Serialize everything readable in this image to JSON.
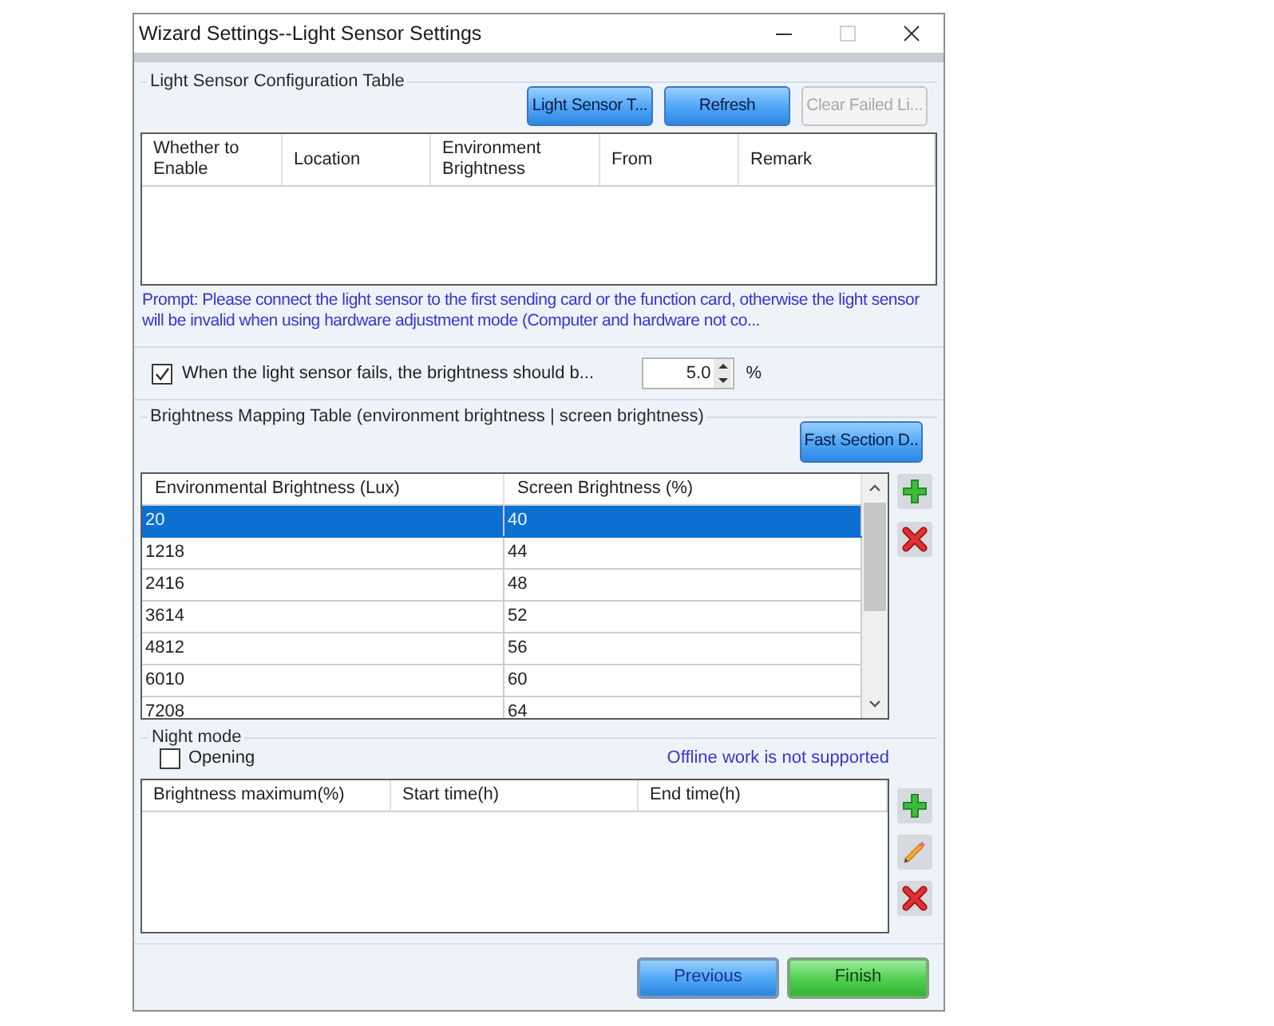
{
  "window": {
    "title": "Wizard Settings--Light Sensor Settings"
  },
  "sensor_config": {
    "title": "Light Sensor Configuration Table",
    "buttons": [
      {
        "label": "Light Sensor T...",
        "disabled": false
      },
      {
        "label": "Refresh",
        "disabled": false
      },
      {
        "label": "Clear Failed Li...",
        "disabled": true
      }
    ],
    "table": {
      "columns": [
        "Whether to Enable",
        "Location",
        "Environment Brightness",
        "From",
        "Remark"
      ]
    },
    "prompt": "Prompt: Please connect the light sensor to the first sending card or the function card, otherwise the light sensor will be invalid when using hardware adjustment mode (Computer and hardware not co..."
  },
  "failure_brightness": {
    "label": "When the light sensor fails, the brightness should b...",
    "checked": true,
    "value": "5.0",
    "unit": "%"
  },
  "mapping": {
    "title": "Brightness Mapping Table (environment brightness | screen brightness)",
    "button": {
      "label": "Fast Section D.."
    },
    "table": {
      "columns": [
        "Environmental Brightness (Lux)",
        "Screen Brightness (%)"
      ],
      "rows": [
        {
          "cells": [
            "20",
            "40"
          ],
          "selected": true
        },
        {
          "cells": [
            "1218",
            "44"
          ],
          "selected": false
        },
        {
          "cells": [
            "2416",
            "48"
          ],
          "selected": false
        },
        {
          "cells": [
            "3614",
            "52"
          ],
          "selected": false
        },
        {
          "cells": [
            "4812",
            "56"
          ],
          "selected": false
        },
        {
          "cells": [
            "6010",
            "60"
          ],
          "selected": false
        },
        {
          "cells": [
            "7208",
            "64"
          ],
          "selected": false
        }
      ]
    },
    "tools": [
      {
        "kind": "add"
      },
      {
        "kind": "delete"
      }
    ]
  },
  "night_mode": {
    "title": "Night mode",
    "option": {
      "label": "Opening",
      "checked": false
    },
    "note": "Offline work is not supported",
    "table": {
      "columns": [
        "Brightness maximum(%)",
        "Start time(h)",
        "End time(h)"
      ]
    },
    "tools": [
      {
        "kind": "add"
      },
      {
        "kind": "edit"
      },
      {
        "kind": "delete"
      }
    ]
  },
  "footer": {
    "buttons": [
      {
        "label": "Previous",
        "kind": "back"
      },
      {
        "label": "Finish",
        "kind": "finish"
      }
    ]
  }
}
